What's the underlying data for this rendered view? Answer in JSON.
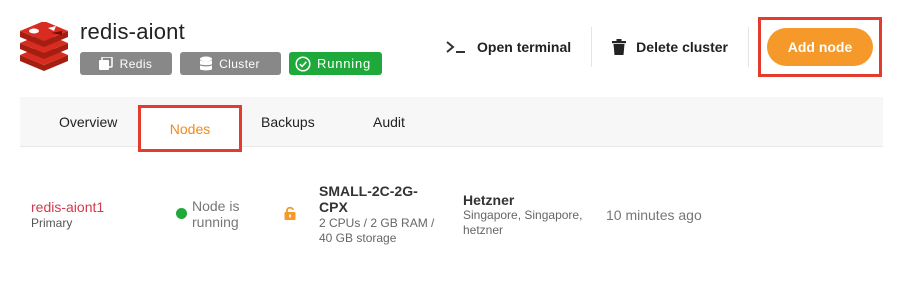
{
  "cluster": {
    "name": "redis-aiont",
    "badges": {
      "engine": "Redis",
      "type": "Cluster",
      "status": "Running"
    }
  },
  "actions": {
    "open_terminal": "Open terminal",
    "delete_cluster": "Delete cluster",
    "add_node": "Add node"
  },
  "tabs": [
    "Overview",
    "Nodes",
    "Backups",
    "Audit"
  ],
  "active_tab": "Nodes",
  "nodes": [
    {
      "name": "redis-aiont1",
      "role": "Primary",
      "status": "Node is running",
      "plan": "SMALL-2C-2G-CPX",
      "spec": "2 CPUs / 2 GB RAM / 40 GB storage",
      "provider": "Hetzner",
      "region": "Singapore, Singapore, hetzner",
      "created": "10 minutes ago"
    }
  ],
  "icons": {
    "logo": "redis-logo-icon",
    "engine_badge": "redis-stack-icon",
    "type_badge": "database-icon",
    "status_badge": "check-circle-icon",
    "terminal": "terminal-icon",
    "delete": "trash-icon",
    "node_status": "status-dot-icon",
    "lock": "unlock-icon"
  },
  "colors": {
    "accent": "#f59a2a",
    "running": "#1fa93a",
    "node_link": "#d23b4c",
    "badge_grey": "#888888",
    "highlight_box": "#e33b2e"
  }
}
